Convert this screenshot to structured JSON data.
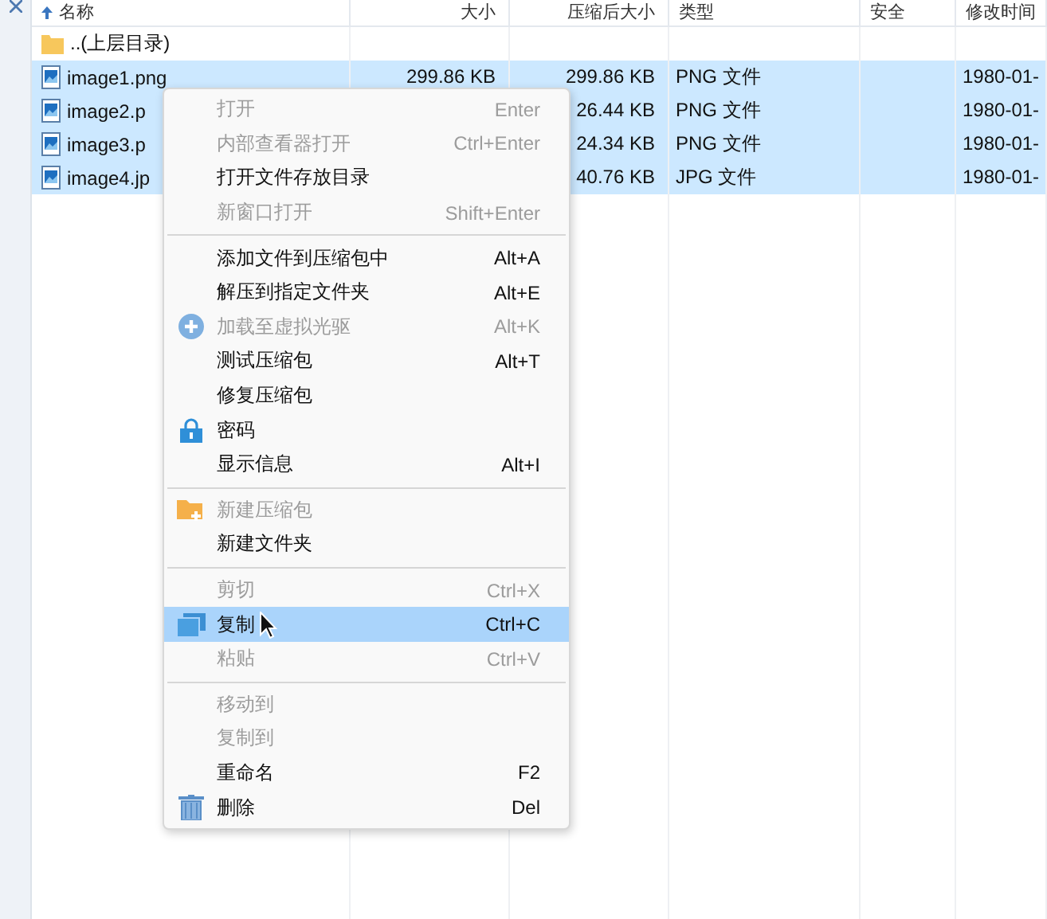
{
  "columns": [
    {
      "label": "名称",
      "sorted": true
    },
    {
      "label": "大小",
      "sorted": false
    },
    {
      "label": "压缩后大小",
      "sorted": false
    },
    {
      "label": "类型",
      "sorted": false
    },
    {
      "label": "安全",
      "sorted": false
    },
    {
      "label": "修改时间",
      "sorted": false
    }
  ],
  "rows": [
    {
      "kind": "folder",
      "selected": false,
      "cells": [
        "..(上层目录)",
        "",
        "",
        "",
        "",
        ""
      ]
    },
    {
      "kind": "image",
      "selected": true,
      "cells": [
        "image1.png",
        "299.86 KB",
        "299.86 KB",
        "PNG 文件",
        "",
        "1980-01-"
      ]
    },
    {
      "kind": "image",
      "selected": true,
      "cells": [
        "image2.p",
        "",
        "26.44 KB",
        "PNG 文件",
        "",
        "1980-01-"
      ]
    },
    {
      "kind": "image",
      "selected": true,
      "cells": [
        "image3.p",
        "",
        "24.34 KB",
        "PNG 文件",
        "",
        "1980-01-"
      ]
    },
    {
      "kind": "image",
      "selected": true,
      "cells": [
        "image4.jp",
        "",
        "40.76 KB",
        "JPG 文件",
        "",
        "1980-01-"
      ]
    }
  ],
  "menu": [
    {
      "kind": "item",
      "label": "打开",
      "shortcut": "Enter",
      "disabled": true,
      "selected": false
    },
    {
      "kind": "item",
      "label": "内部查看器打开",
      "shortcut": "Ctrl+Enter",
      "disabled": true,
      "selected": false
    },
    {
      "kind": "item",
      "label": "打开文件存放目录",
      "disabled": false,
      "selected": false
    },
    {
      "kind": "item",
      "label": "新窗口打开",
      "shortcut": "Shift+Enter",
      "disabled": true,
      "selected": false
    },
    {
      "kind": "separator"
    },
    {
      "kind": "item",
      "label": "添加文件到压缩包中",
      "shortcut": "Alt+A",
      "disabled": false,
      "selected": false
    },
    {
      "kind": "item",
      "label": "解压到指定文件夹",
      "shortcut": "Alt+E",
      "disabled": false,
      "selected": false
    },
    {
      "kind": "item",
      "label": "加载至虚拟光驱",
      "shortcut": "Alt+K",
      "disabled": true,
      "selected": false
    },
    {
      "kind": "item",
      "label": "测试压缩包",
      "shortcut": "Alt+T",
      "disabled": false,
      "selected": false
    },
    {
      "kind": "item",
      "label": "修复压缩包",
      "disabled": false,
      "selected": false
    },
    {
      "kind": "item",
      "label": "密码",
      "disabled": false,
      "selected": false
    },
    {
      "kind": "item",
      "label": "显示信息",
      "shortcut": "Alt+I",
      "disabled": false,
      "selected": false
    },
    {
      "kind": "separator"
    },
    {
      "kind": "item",
      "label": "新建压缩包",
      "disabled": true,
      "selected": false
    },
    {
      "kind": "item",
      "label": "新建文件夹",
      "disabled": false,
      "selected": false
    },
    {
      "kind": "separator"
    },
    {
      "kind": "item",
      "label": "剪切",
      "shortcut": "Ctrl+X",
      "disabled": true,
      "selected": false
    },
    {
      "kind": "item",
      "label": "复制",
      "shortcut": "Ctrl+C",
      "disabled": false,
      "selected": true
    },
    {
      "kind": "item",
      "label": "粘贴",
      "shortcut": "Ctrl+V",
      "disabled": true,
      "selected": false
    },
    {
      "kind": "separator"
    },
    {
      "kind": "item",
      "label": "移动到",
      "disabled": true,
      "selected": false
    },
    {
      "kind": "item",
      "label": "复制到",
      "disabled": true,
      "selected": false
    },
    {
      "kind": "item",
      "label": "重命名",
      "shortcut": "F2",
      "disabled": false,
      "selected": false
    },
    {
      "kind": "item",
      "label": "删除",
      "shortcut": "Del",
      "disabled": false,
      "selected": false
    }
  ]
}
